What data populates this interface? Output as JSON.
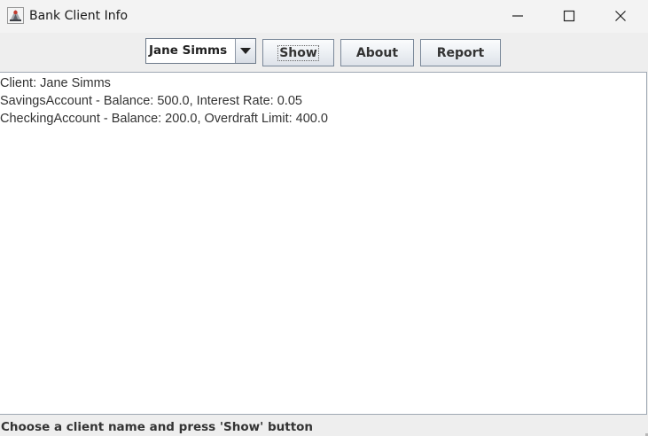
{
  "window": {
    "title": "Bank Client Info",
    "icon": "java-app-icon",
    "controls": {
      "minimize": "minimize-icon",
      "maximize": "maximize-icon",
      "close": "close-icon"
    }
  },
  "toolbar": {
    "client_select": {
      "selected": "Jane Simms",
      "arrow_icon": "chevron-down-icon"
    },
    "show_label": "Show",
    "about_label": "About",
    "report_label": "Report"
  },
  "output": {
    "lines": [
      "Client: Jane Simms",
      "SavingsAccount - Balance: 500.0, Interest Rate: 0.05",
      "CheckingAccount - Balance: 200.0, Overdraft Limit: 400.0"
    ]
  },
  "status": {
    "message": "Choose a client name and press 'Show' button"
  },
  "colors": {
    "window_bg": "#eeeeee",
    "titlebar_bg": "#f3f3f3",
    "button_border": "#7a8899",
    "text": "#333333"
  }
}
